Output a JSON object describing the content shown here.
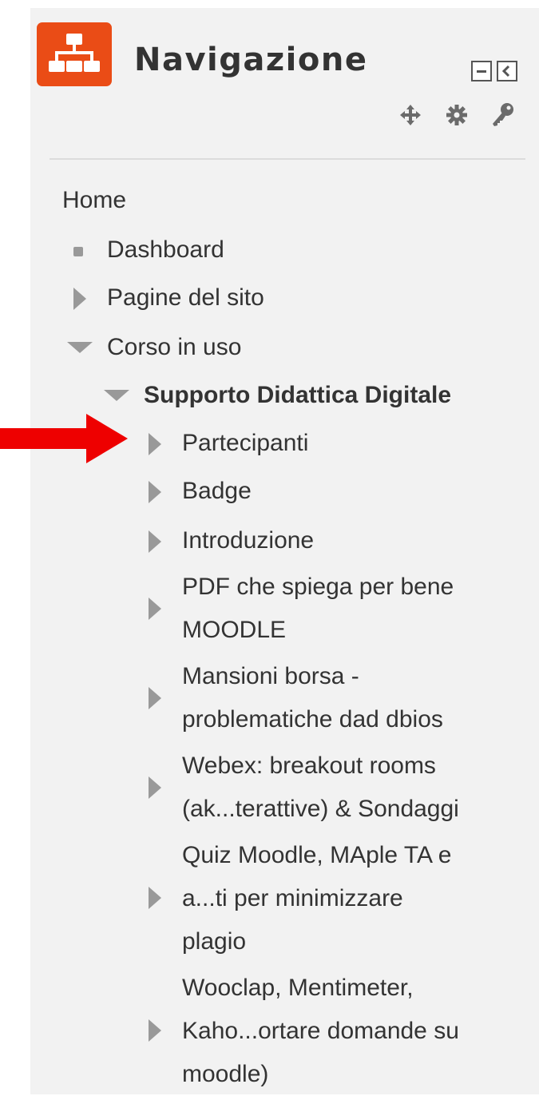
{
  "block": {
    "title": "Navigazione",
    "icon": "sitemap-icon",
    "accent_color": "#ea4c16",
    "controls": [
      "collapse-icon",
      "dock-icon",
      "move-icon",
      "gear-icon",
      "key-icon"
    ]
  },
  "nav": {
    "home": "Home",
    "dashboard": "Dashboard",
    "site_pages": "Pagine del sito",
    "current_course": "Corso in uso",
    "course_name": "Supporto Didattica Digitale",
    "items": [
      {
        "lines": [
          "Partecipanti"
        ]
      },
      {
        "lines": [
          "Badge"
        ]
      },
      {
        "lines": [
          "Introduzione"
        ]
      },
      {
        "lines": [
          "PDF che spiega per bene",
          "MOODLE"
        ]
      },
      {
        "lines": [
          "Mansioni borsa -",
          "problematiche dad dbios"
        ]
      },
      {
        "lines": [
          "Webex: breakout rooms",
          "(ak...terattive) & Sondaggi"
        ]
      },
      {
        "lines": [
          "Quiz Moodle, MAple TA e",
          "a...ti per minimizzare",
          "plagio"
        ]
      },
      {
        "lines": [
          "Wooclap, Mentimeter,",
          "Kaho...ortare domande su",
          "moodle)"
        ]
      }
    ]
  },
  "annotation": {
    "icon": "red-arrow-icon",
    "color": "#ee0000"
  }
}
